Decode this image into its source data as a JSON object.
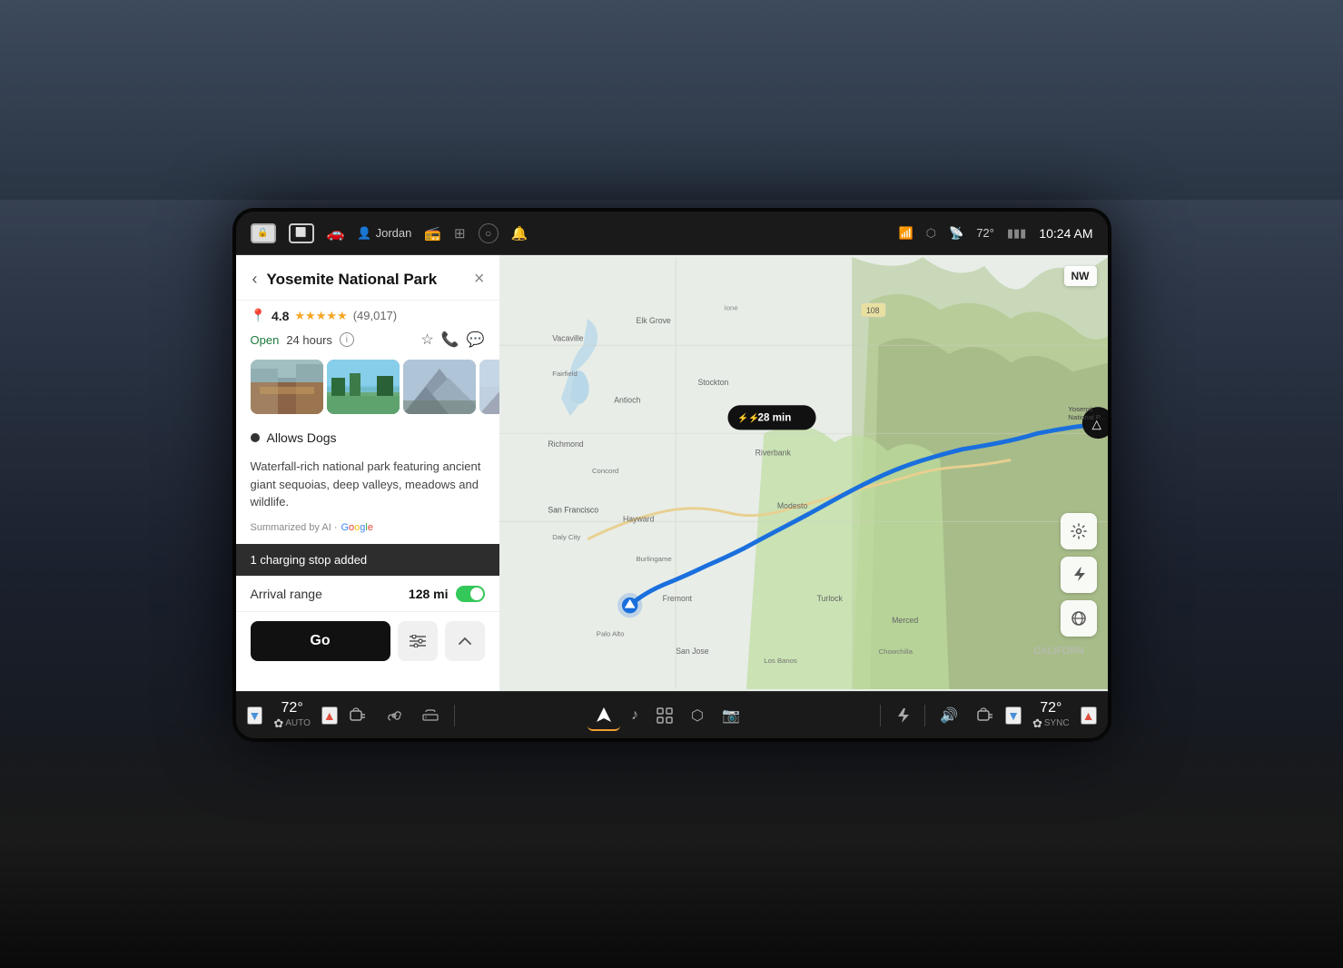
{
  "status_bar": {
    "user": "Jordan",
    "temperature": "72°",
    "time": "10:24 AM",
    "signal_bars": "▮▮▮",
    "wifi_icon": "wifi",
    "bluetooth_icon": "bluetooth"
  },
  "place_panel": {
    "title": "Yosemite National Park",
    "rating": "4.8",
    "review_count": "(49,017)",
    "hours": "Open",
    "hours_detail": "24 hours",
    "allows_dogs": "Allows Dogs",
    "description": "Waterfall-rich national park featuring ancient giant sequoias, deep valleys, meadows and wildlife.",
    "ai_summary_prefix": "Summarized by AI ·",
    "charging_stop": "1 charging stop added",
    "arrival_range_label": "Arrival range",
    "arrival_range_value": "128 mi",
    "go_button": "Go",
    "back_label": "‹",
    "close_label": "×"
  },
  "map": {
    "direction_label": "NW",
    "eta_minutes": "28 min",
    "lightning_icons": "⚡⚡",
    "california_label": "CALIFORN"
  },
  "bottom_nav": {
    "left_temp": "72°",
    "left_mode": "AUTO",
    "right_temp": "72°",
    "right_mode": "SYNC",
    "nav_icon": "▶",
    "music_icon": "♪",
    "apps_icon": "⊞",
    "alert_icon": "🔔",
    "video_icon": "▶",
    "bolt_icon": "⚡",
    "volume_icon": "🔊",
    "fan_icon": "≋"
  }
}
